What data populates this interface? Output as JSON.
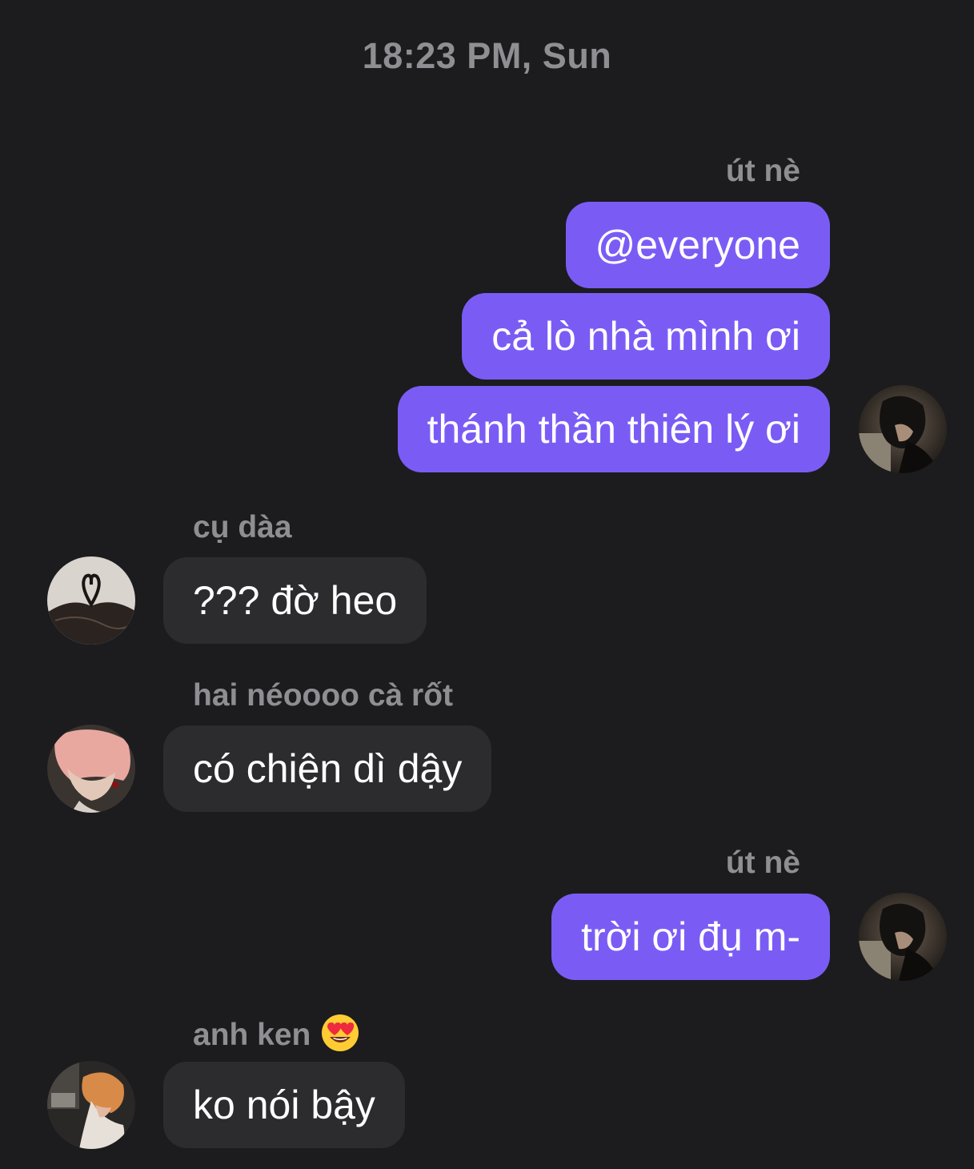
{
  "conversation": {
    "timestamp": "18:23 PM, Sun",
    "groups": [
      {
        "sender": "út nè",
        "side": "right",
        "avatar_icon": "dark-haired-person-avatar",
        "messages": [
          "@everyone",
          "cả lò nhà mình ơi",
          "thánh thần thiên lý ơi"
        ]
      },
      {
        "sender": "cụ dàa",
        "side": "left",
        "avatar_icon": "heart-shaped-hair-avatar",
        "messages": [
          "??? đờ heo"
        ]
      },
      {
        "sender": "hai néoooo cà rốt",
        "side": "left",
        "avatar_icon": "pink-haired-person-avatar",
        "messages": [
          "có chiện dì dậy"
        ]
      },
      {
        "sender": "út nè",
        "side": "right",
        "avatar_icon": "dark-haired-person-avatar",
        "messages": [
          "trời ơi đụ m-"
        ]
      },
      {
        "sender": "anh ken",
        "sender_emoji": "heart-eyes-emoji-icon",
        "side": "left",
        "avatar_icon": "orange-haired-person-avatar",
        "messages": [
          "ko nói bậy"
        ]
      }
    ]
  },
  "colors": {
    "background": "#1c1c1e",
    "outgoing_bubble": "#7a5cf5",
    "incoming_bubble": "#2c2c2e",
    "secondary_text": "#8e8e93"
  }
}
